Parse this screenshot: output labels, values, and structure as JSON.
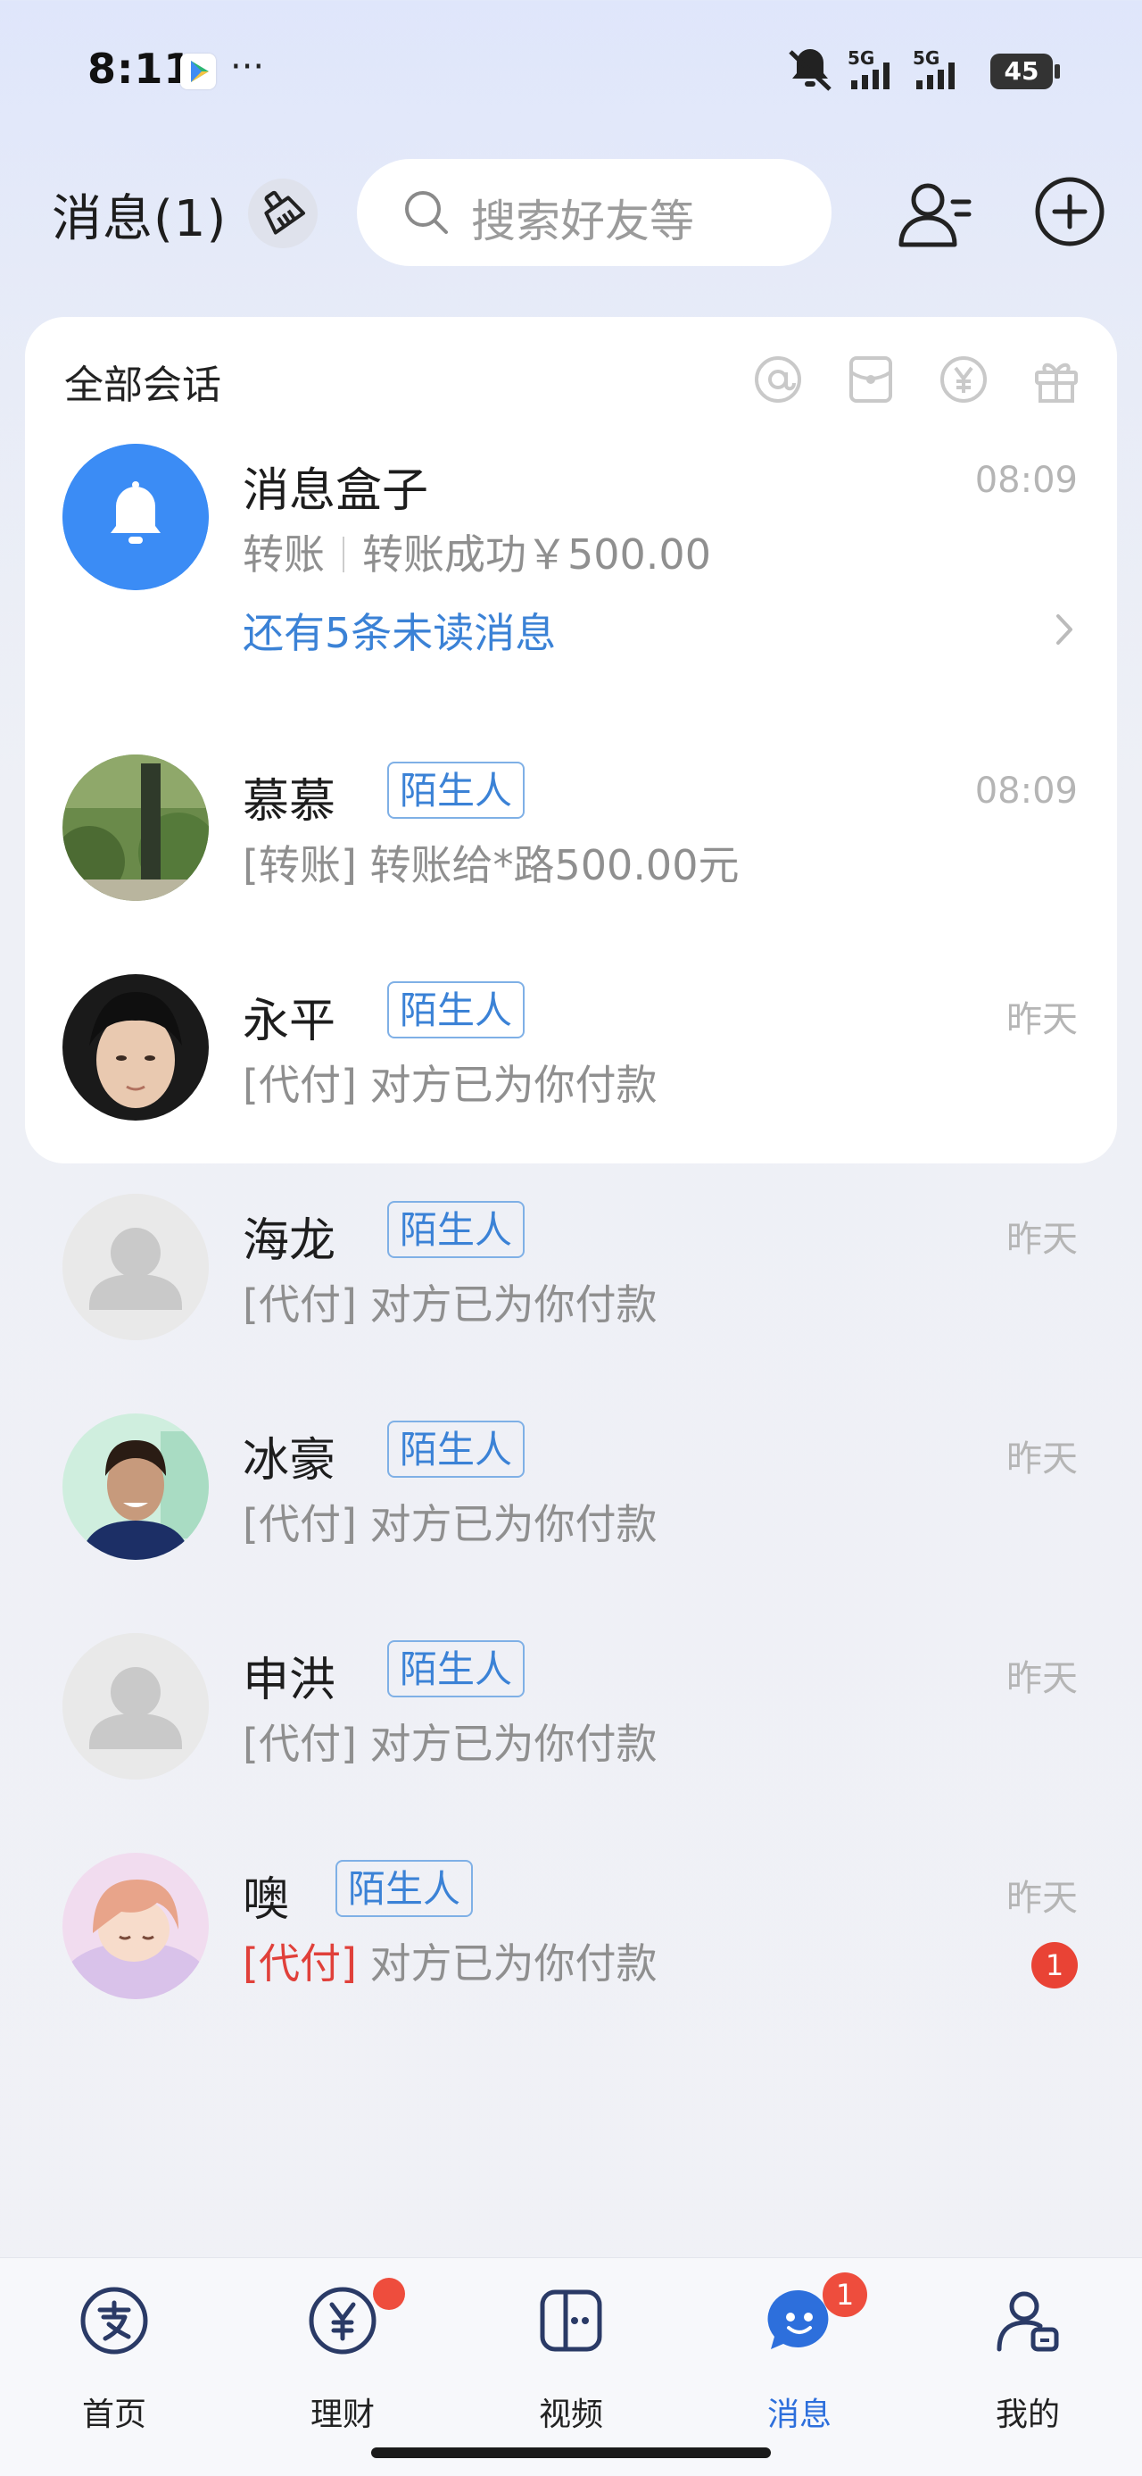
{
  "status_bar": {
    "time": "8:11",
    "more": "···",
    "network_1": "5G",
    "network_2": "5G",
    "battery": "45"
  },
  "header": {
    "title": "消息(1)",
    "search_placeholder": "搜索好友等"
  },
  "card": {
    "title": "全部会话",
    "filters": [
      "at-icon",
      "red-packet-icon",
      "yuan-icon",
      "gift-icon"
    ]
  },
  "conversations": [
    {
      "name": "消息盒子",
      "type_label": "转账",
      "preview": "转账成功￥500.00",
      "time": "08:09",
      "more_text": "还有5条未读消息"
    },
    {
      "name": "慕慕",
      "tag": "陌生人",
      "preview": "[转账] 转账给*路500.00元",
      "time": "08:09"
    },
    {
      "name": "永平",
      "tag": "陌生人",
      "preview": "[代付] 对方已为你付款",
      "time": "昨天"
    },
    {
      "name": "海龙",
      "tag": "陌生人",
      "preview": "[代付] 对方已为你付款",
      "time": "昨天"
    },
    {
      "name": "冰豪",
      "tag": "陌生人",
      "preview": "[代付] 对方已为你付款",
      "time": "昨天"
    },
    {
      "name": "申洪",
      "tag": "陌生人",
      "preview": "[代付] 对方已为你付款",
      "time": "昨天"
    },
    {
      "name": "噢",
      "tag": "陌生人",
      "preview_prefix": "[代付]",
      "preview": " 对方已为你付款",
      "time": "昨天",
      "unread": "1"
    }
  ],
  "nav": {
    "items": [
      {
        "label": "首页"
      },
      {
        "label": "理财"
      },
      {
        "label": "视频"
      },
      {
        "label": "消息",
        "badge": "1"
      },
      {
        "label": "我的"
      }
    ]
  },
  "colors": {
    "accent": "#2d6fdc",
    "badge": "#ee4d3d",
    "tag_text": "#3b82d6"
  }
}
